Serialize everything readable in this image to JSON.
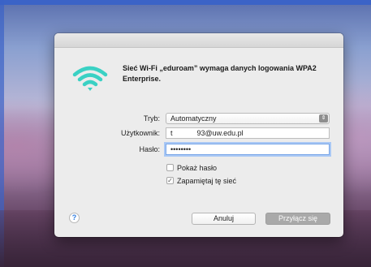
{
  "dialog": {
    "heading": "Sieć Wi-Fi „eduroam” wymaga danych logowania WPA2 Enterprise."
  },
  "form": {
    "mode_label": "Tryb:",
    "mode_value": "Automatyczny",
    "username_label": "Użytkownik:",
    "username_value": "t            93@uw.edu.pl",
    "password_label": "Hasło:",
    "password_value": "••••••••"
  },
  "options": {
    "show_password_label": "Pokaż hasło",
    "show_password_checked": false,
    "remember_network_label": "Zapamiętaj tę sieć",
    "remember_network_checked": true
  },
  "buttons": {
    "help": "?",
    "cancel": "Anuluj",
    "connect": "Przyłącz się"
  },
  "colors": {
    "wifi_icon": "#3ad1c4",
    "help_icon": "#2f7ce0",
    "focus_ring": "#a9c8f5"
  },
  "icons": {
    "wifi": "wifi-icon",
    "select_arrows": "updown-arrows-icon",
    "check": "checkmark-icon",
    "help": "question-mark-icon"
  }
}
